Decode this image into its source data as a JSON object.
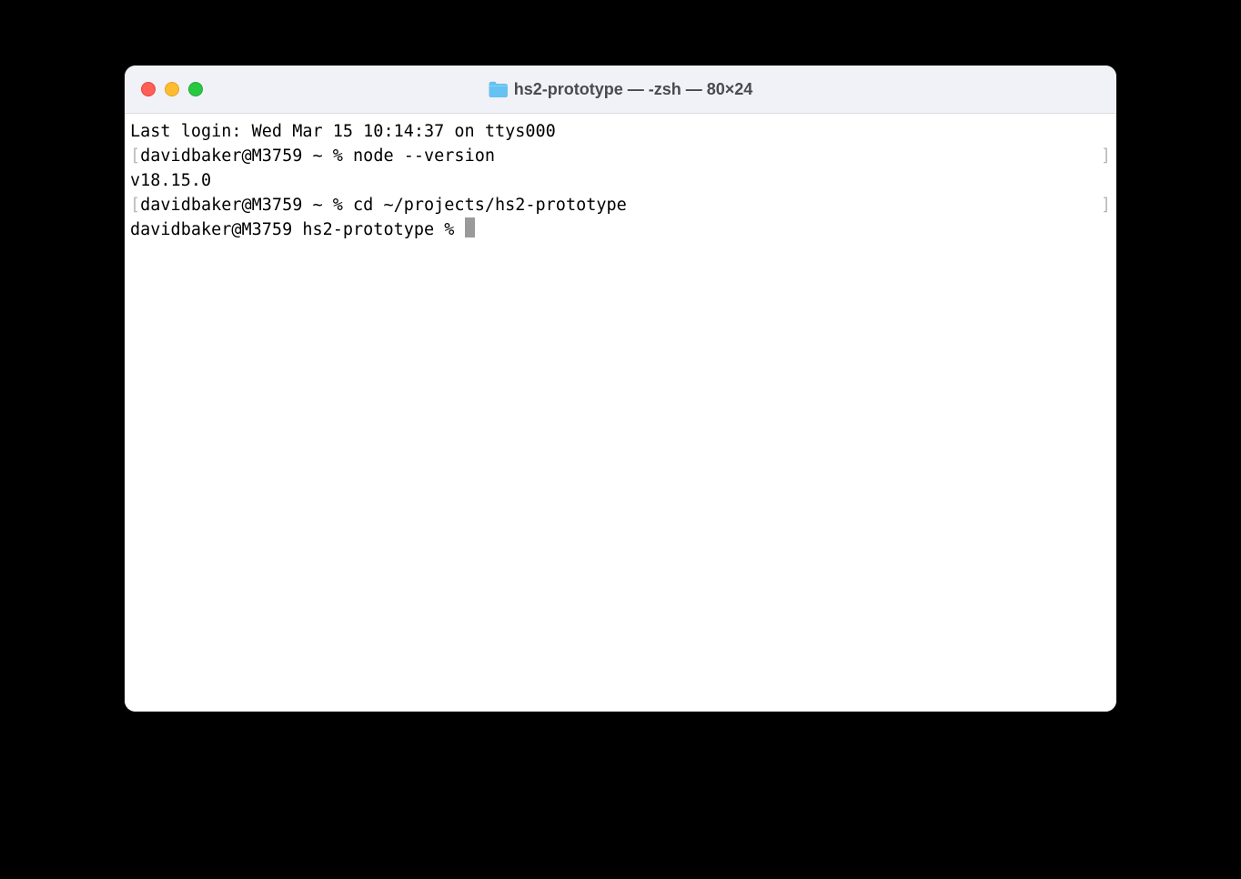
{
  "window": {
    "title": "hs2-prototype — -zsh — 80×24"
  },
  "terminal": {
    "last_login": "Last login: Wed Mar 15 10:14:37 on ttys000",
    "line1_prompt": "davidbaker@M3759 ~ % ",
    "line1_cmd": "node --version",
    "line2_output": "v18.15.0",
    "line3_prompt": "davidbaker@M3759 ~ % ",
    "line3_cmd": "cd ~/projects/hs2-prototype",
    "line4_prompt": "davidbaker@M3759 hs2-prototype % ",
    "bracket_left": "[",
    "bracket_right": "]"
  }
}
